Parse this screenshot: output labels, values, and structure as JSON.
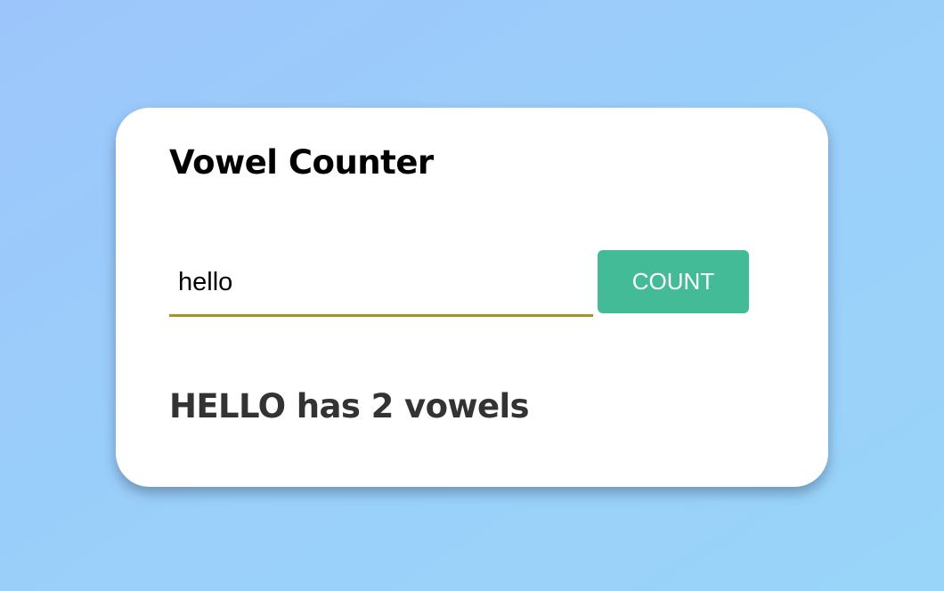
{
  "app": {
    "title": "Vowel Counter"
  },
  "form": {
    "input_value": "hello",
    "button_label": "COUNT"
  },
  "result": {
    "text": "HELLO has 2 vowels"
  },
  "colors": {
    "background_top": "#9cc6fb",
    "background_bottom": "#99d4f9",
    "card": "#ffffff",
    "input_underline": "#a19628",
    "button": "#43bb96",
    "button_text": "#ffffff",
    "result_text": "#333333"
  }
}
